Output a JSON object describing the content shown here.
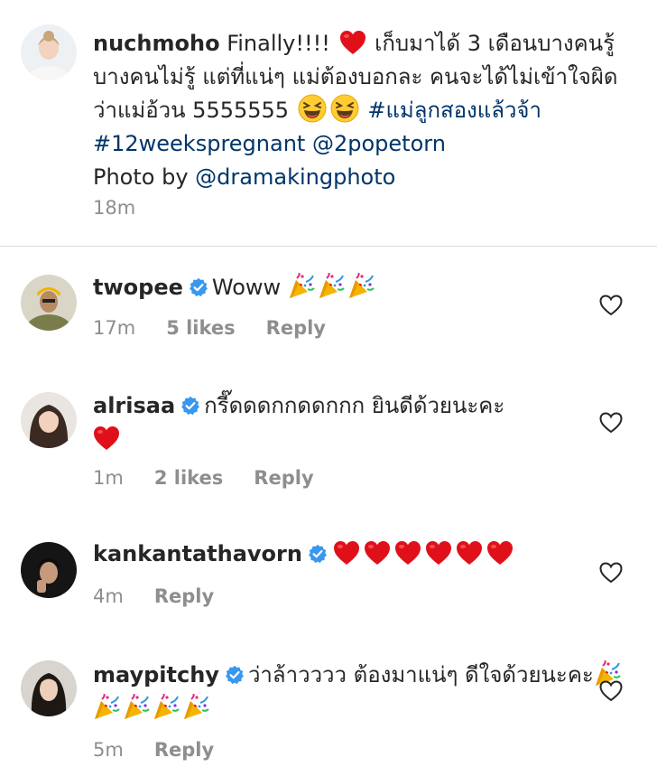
{
  "caption": {
    "username": "nuchmoho",
    "text_1": "Finally!!!!",
    "text_2": "เก็บมาได้ 3 เดือนบางคนรู้ บางคนไม่รู้ แต่ที่แน่ๆ แม่ต้องบอกละ คนจะได้ไม่เข้าใจผิดว่าแม่อ้วน 5555555",
    "hashtag_1": "#แม่ลูกสองแล้วจ้า",
    "hashtag_2": "#12weekspregnant",
    "mention_1": "@2popetorn",
    "photo_by": "Photo by",
    "mention_2": "@dramakingphoto",
    "time": "18m"
  },
  "comments": [
    {
      "username": "twopee",
      "text": "Woww",
      "time": "17m",
      "likes": "5 likes",
      "reply": "Reply"
    },
    {
      "username": "alrisaa",
      "text": "กรี๊ดดดกกดดกกก ยินดีด้วยนะคะ",
      "time": "1m",
      "likes": "2 likes",
      "reply": "Reply"
    },
    {
      "username": "kankantathavorn",
      "text": "",
      "time": "4m",
      "likes": "",
      "reply": "Reply"
    },
    {
      "username": "maypitchy",
      "text": "ว่าล้าวววว ต้องมาแน่ๆ ดีใจด้วยนะคะ",
      "time": "5m",
      "likes": "",
      "reply": "Reply"
    }
  ],
  "icons": {
    "verified": "verified-badge-icon",
    "heart_outline": "heart-outline-icon",
    "heart_emoji": "red-heart-emoji",
    "party_emoji": "party-popper-emoji",
    "laugh_emoji": "grinning-squinting-face-emoji"
  },
  "colors": {
    "link": "#003569",
    "verified": "#3897f0",
    "meta_gray": "#8e8e8e",
    "divider": "#dbdbdb",
    "heart_red": "#e0101a"
  }
}
